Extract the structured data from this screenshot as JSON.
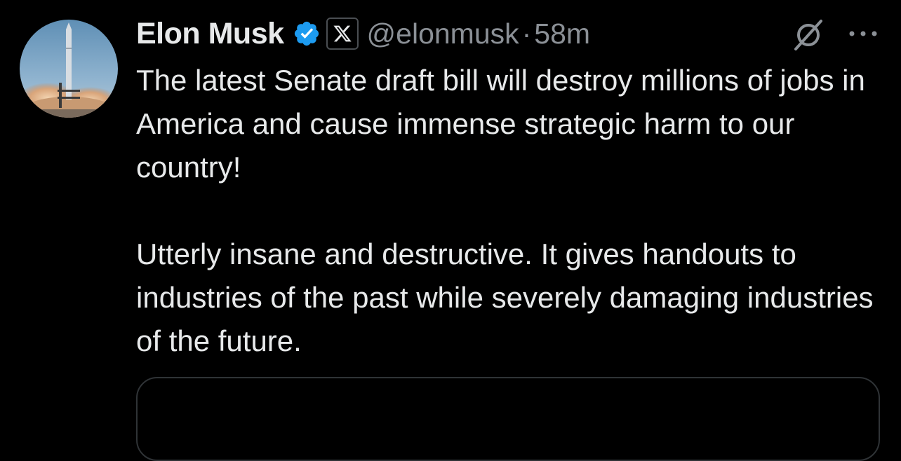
{
  "tweet": {
    "author": {
      "display_name": "Elon Musk",
      "handle": "@elonmusk",
      "verified": true,
      "affiliate_badge": "X"
    },
    "separator": "·",
    "timestamp": "58m",
    "body": [
      "The latest Senate draft bill will destroy millions of jobs in America and cause immense strategic harm to our country!",
      "Utterly insane and destructive. It gives handouts to industries of the past while severely damaging industries of the future."
    ]
  },
  "icons": {
    "verified": "verified-badge-icon",
    "affiliate": "x-logo-icon",
    "grok": "grok-icon",
    "more": "more-options-icon",
    "avatar": "rocket-launch-avatar"
  },
  "colors": {
    "background": "#000000",
    "text_primary": "#e7e9ea",
    "text_secondary": "#8b9096",
    "verified_blue": "#1d9bf0",
    "card_border": "#2f3336"
  }
}
